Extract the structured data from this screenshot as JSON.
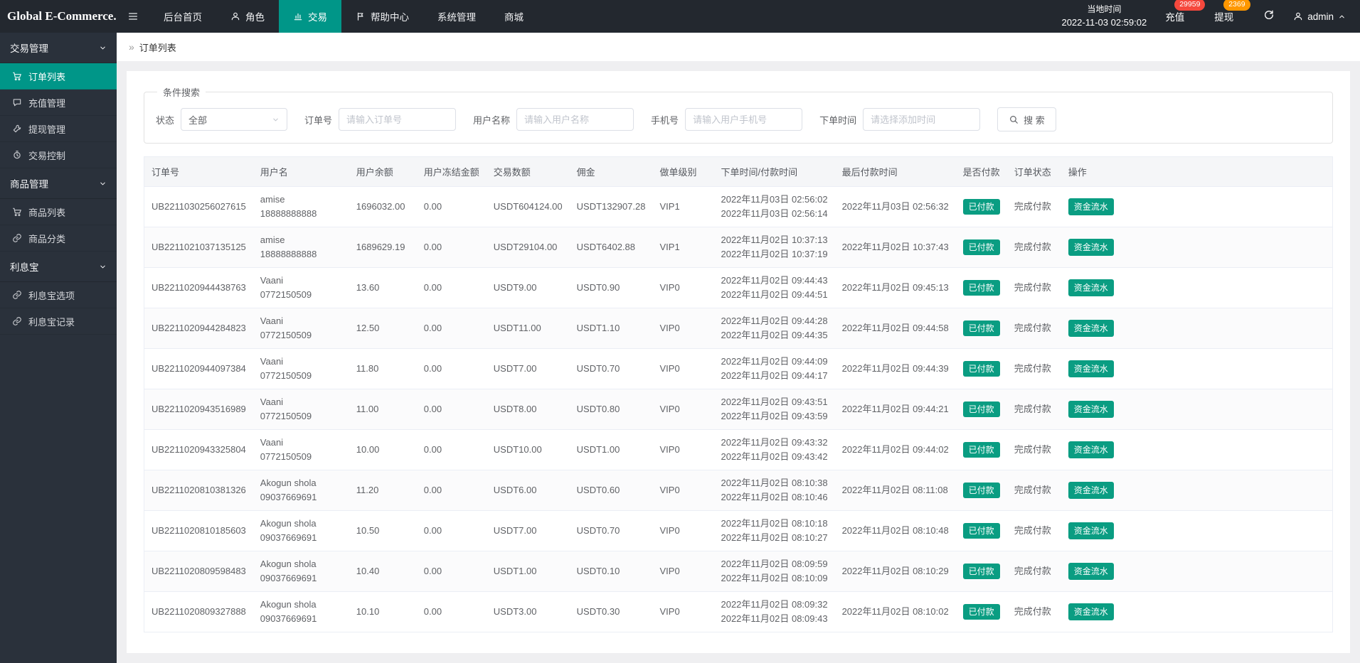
{
  "theme": {
    "accent_teal": "#009688",
    "badge_green": "#0a9d82",
    "badge_red": "#f5483d",
    "badge_orange": "#ff9700",
    "topbar_dark": "#23282f",
    "sidebar_dark": "#2a313b"
  },
  "navbar": {
    "logo": "Global E-Commerce...",
    "menu_icon": "hamburger-icon",
    "items": [
      {
        "label": "后台首页"
      },
      {
        "label": "角色",
        "icon": "person-icon"
      },
      {
        "label": "交易",
        "icon": "trade-icon",
        "active": true
      },
      {
        "label": "帮助中心",
        "icon": "flag-icon"
      },
      {
        "label": "系统管理"
      },
      {
        "label": "商城"
      }
    ],
    "local_time_label": "当地时间",
    "local_time_value": "2022-11-03 02:59:02",
    "recharge_label": "充值",
    "recharge_badge": "29959",
    "withdraw_label": "提现",
    "withdraw_badge": "2369",
    "refresh_icon": "refresh-icon",
    "username": "admin"
  },
  "sidebar": {
    "groups": [
      {
        "label": "交易管理",
        "items": [
          {
            "label": "订单列表",
            "icon": "cart-icon",
            "active": true
          },
          {
            "label": "充值管理",
            "icon": "comment-icon"
          },
          {
            "label": "提现管理",
            "icon": "wrench-icon"
          },
          {
            "label": "交易控制",
            "icon": "clock-icon"
          }
        ]
      },
      {
        "label": "商品管理",
        "items": [
          {
            "label": "商品列表",
            "icon": "cart-icon"
          },
          {
            "label": "商品分类",
            "icon": "link-icon"
          }
        ]
      },
      {
        "label": "利息宝",
        "items": [
          {
            "label": "利息宝选项",
            "icon": "link-icon"
          },
          {
            "label": "利息宝记录",
            "icon": "link-icon"
          }
        ]
      }
    ]
  },
  "breadcrumb": {
    "icon": "»",
    "label": "订单列表"
  },
  "filters": {
    "legend": "条件搜索",
    "status_label": "状态",
    "status_value": "全部",
    "order_label": "订单号",
    "order_placeholder": "请输入订单号",
    "username_label": "用户名称",
    "username_placeholder": "请输入用户名称",
    "phone_label": "手机号",
    "phone_placeholder": "请输入用户手机号",
    "time_label": "下单时间",
    "time_placeholder": "请选择添加时间",
    "search_label": "搜 索"
  },
  "table": {
    "columns": [
      "订单号",
      "用户名",
      "用户余额",
      "用户冻结金额",
      "交易数额",
      "佣金",
      "做单级别",
      "下单时间/付款时间",
      "最后付款时间",
      "是否付款",
      "订单状态",
      "操作"
    ],
    "rows": [
      {
        "order_no": "UB2211030256027615",
        "user_name": "amise",
        "user_phone": "18888888888",
        "balance": "1696032.00",
        "frozen": "0.00",
        "amount": "USDT604124.00",
        "commission": "USDT132907.28",
        "level": "VIP1",
        "order_time": "2022年11月03日 02:56:02",
        "pay_time": "2022年11月03日 02:56:14",
        "last_pay_time": "2022年11月03日 02:56:32",
        "paid": "已付款",
        "status": "完成付款",
        "action": "资金流水"
      },
      {
        "order_no": "UB2211021037135125",
        "user_name": "amise",
        "user_phone": "18888888888",
        "balance": "1689629.19",
        "frozen": "0.00",
        "amount": "USDT29104.00",
        "commission": "USDT6402.88",
        "level": "VIP1",
        "order_time": "2022年11月02日 10:37:13",
        "pay_time": "2022年11月02日 10:37:19",
        "last_pay_time": "2022年11月02日 10:37:43",
        "paid": "已付款",
        "status": "完成付款",
        "action": "资金流水"
      },
      {
        "order_no": "UB2211020944438763",
        "user_name": "Vaani",
        "user_phone": "0772150509",
        "balance": "13.60",
        "frozen": "0.00",
        "amount": "USDT9.00",
        "commission": "USDT0.90",
        "level": "VIP0",
        "order_time": "2022年11月02日 09:44:43",
        "pay_time": "2022年11月02日 09:44:51",
        "last_pay_time": "2022年11月02日 09:45:13",
        "paid": "已付款",
        "status": "完成付款",
        "action": "资金流水"
      },
      {
        "order_no": "UB2211020944284823",
        "user_name": "Vaani",
        "user_phone": "0772150509",
        "balance": "12.50",
        "frozen": "0.00",
        "amount": "USDT11.00",
        "commission": "USDT1.10",
        "level": "VIP0",
        "order_time": "2022年11月02日 09:44:28",
        "pay_time": "2022年11月02日 09:44:35",
        "last_pay_time": "2022年11月02日 09:44:58",
        "paid": "已付款",
        "status": "完成付款",
        "action": "资金流水"
      },
      {
        "order_no": "UB2211020944097384",
        "user_name": "Vaani",
        "user_phone": "0772150509",
        "balance": "11.80",
        "frozen": "0.00",
        "amount": "USDT7.00",
        "commission": "USDT0.70",
        "level": "VIP0",
        "order_time": "2022年11月02日 09:44:09",
        "pay_time": "2022年11月02日 09:44:17",
        "last_pay_time": "2022年11月02日 09:44:39",
        "paid": "已付款",
        "status": "完成付款",
        "action": "资金流水"
      },
      {
        "order_no": "UB2211020943516989",
        "user_name": "Vaani",
        "user_phone": "0772150509",
        "balance": "11.00",
        "frozen": "0.00",
        "amount": "USDT8.00",
        "commission": "USDT0.80",
        "level": "VIP0",
        "order_time": "2022年11月02日 09:43:51",
        "pay_time": "2022年11月02日 09:43:59",
        "last_pay_time": "2022年11月02日 09:44:21",
        "paid": "已付款",
        "status": "完成付款",
        "action": "资金流水"
      },
      {
        "order_no": "UB2211020943325804",
        "user_name": "Vaani",
        "user_phone": "0772150509",
        "balance": "10.00",
        "frozen": "0.00",
        "amount": "USDT10.00",
        "commission": "USDT1.00",
        "level": "VIP0",
        "order_time": "2022年11月02日 09:43:32",
        "pay_time": "2022年11月02日 09:43:42",
        "last_pay_time": "2022年11月02日 09:44:02",
        "paid": "已付款",
        "status": "完成付款",
        "action": "资金流水"
      },
      {
        "order_no": "UB2211020810381326",
        "user_name": "Akogun shola",
        "user_phone": "09037669691",
        "balance": "11.20",
        "frozen": "0.00",
        "amount": "USDT6.00",
        "commission": "USDT0.60",
        "level": "VIP0",
        "order_time": "2022年11月02日 08:10:38",
        "pay_time": "2022年11月02日 08:10:46",
        "last_pay_time": "2022年11月02日 08:11:08",
        "paid": "已付款",
        "status": "完成付款",
        "action": "资金流水"
      },
      {
        "order_no": "UB2211020810185603",
        "user_name": "Akogun shola",
        "user_phone": "09037669691",
        "balance": "10.50",
        "frozen": "0.00",
        "amount": "USDT7.00",
        "commission": "USDT0.70",
        "level": "VIP0",
        "order_time": "2022年11月02日 08:10:18",
        "pay_time": "2022年11月02日 08:10:27",
        "last_pay_time": "2022年11月02日 08:10:48",
        "paid": "已付款",
        "status": "完成付款",
        "action": "资金流水"
      },
      {
        "order_no": "UB2211020809598483",
        "user_name": "Akogun shola",
        "user_phone": "09037669691",
        "balance": "10.40",
        "frozen": "0.00",
        "amount": "USDT1.00",
        "commission": "USDT0.10",
        "level": "VIP0",
        "order_time": "2022年11月02日 08:09:59",
        "pay_time": "2022年11月02日 08:10:09",
        "last_pay_time": "2022年11月02日 08:10:29",
        "paid": "已付款",
        "status": "完成付款",
        "action": "资金流水"
      },
      {
        "order_no": "UB2211020809327888",
        "user_name": "Akogun shola",
        "user_phone": "09037669691",
        "balance": "10.10",
        "frozen": "0.00",
        "amount": "USDT3.00",
        "commission": "USDT0.30",
        "level": "VIP0",
        "order_time": "2022年11月02日 08:09:32",
        "pay_time": "2022年11月02日 08:09:43",
        "last_pay_time": "2022年11月02日 08:10:02",
        "paid": "已付款",
        "status": "完成付款",
        "action": "资金流水"
      }
    ]
  }
}
